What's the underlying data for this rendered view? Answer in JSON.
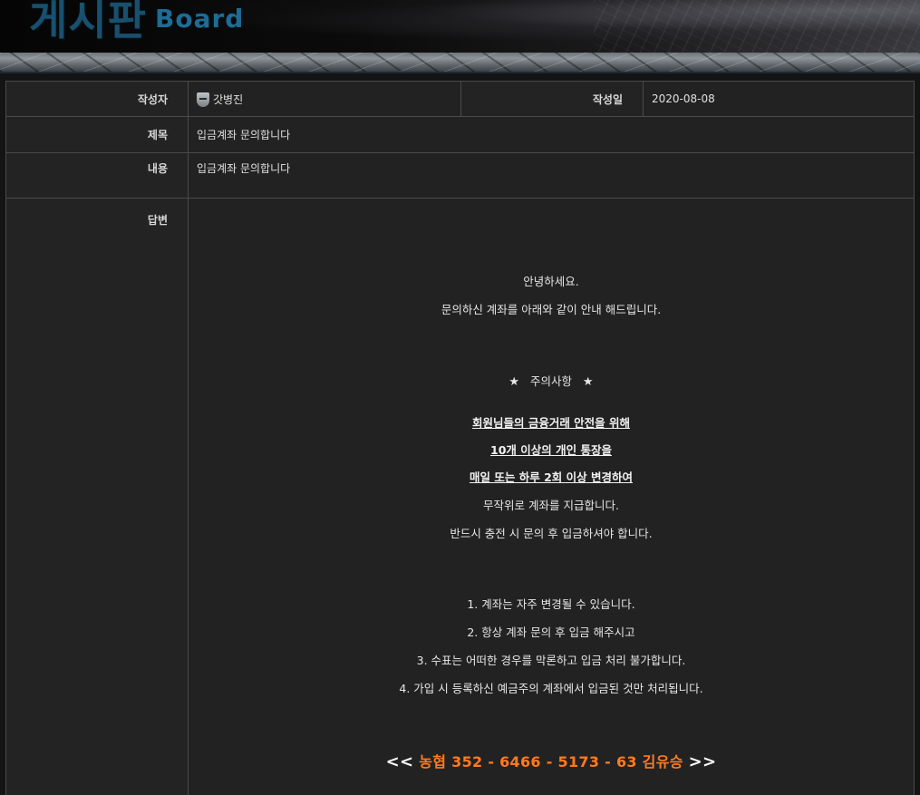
{
  "header": {
    "title": "게시판",
    "subtitle": "Board"
  },
  "post": {
    "author_label": "작성자",
    "author": "갓병진",
    "date_label": "작성일",
    "date": "2020-08-08",
    "subject_label": "제목",
    "subject": "입금계좌 문의합니다",
    "content_label": "내용",
    "content": "입금계좌 문의합니다",
    "reply_label": "답변"
  },
  "reply": {
    "greeting": "안녕하세요.",
    "intro": "문의하신 계좌를 아래와 같이 안내 해드립니다.",
    "notice_title": "주의사항",
    "star": "★",
    "warning_lines": [
      "회원님들의 금융거래 안전을 위해",
      "10개 이상의 개인 통장을",
      "매일 또는 하루 2회 이상 변경하여"
    ],
    "info_lines": [
      "무작위로 계좌를 지급합니다.",
      "반드시 충전 시 문의 후 입금하셔야 합니다."
    ],
    "rules": [
      "1. 계좌는 자주 변경될 수 있습니다.",
      "2. 항상 계좌 문의 후 입금 해주시고",
      "3. 수표는 어떠한 경우를 막론하고 입금 처리 불가합니다.",
      "4. 가입 시 등록하신 예금주의 계좌에서 입금된 것만 처리됩니다."
    ],
    "account_open": "<<",
    "account": "농협 352 - 6466 - 5173 - 63 김유승",
    "account_close": ">>"
  },
  "colors": {
    "accent": "#ff7a1f",
    "title": "#18506e"
  }
}
